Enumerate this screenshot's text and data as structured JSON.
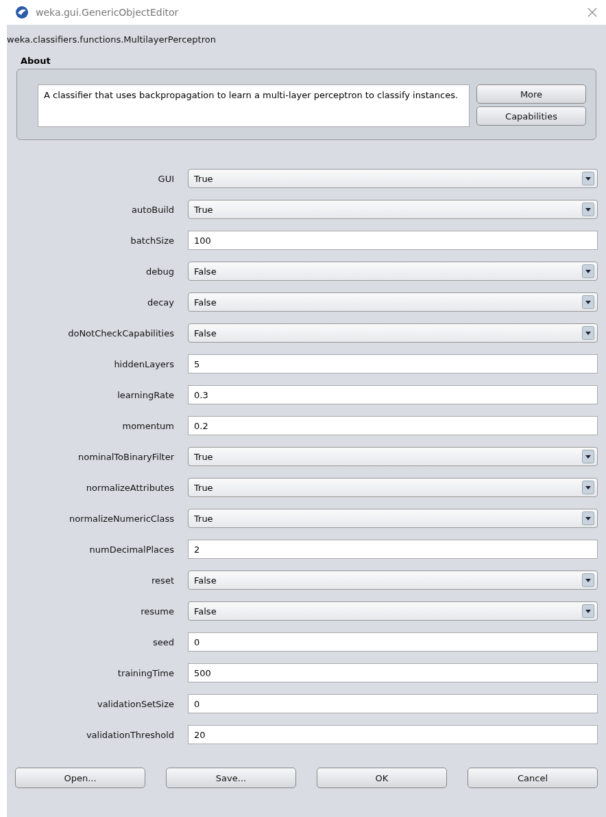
{
  "window": {
    "title": "weka.gui.GenericObjectEditor"
  },
  "class_name": "weka.classifiers.functions.MultilayerPerceptron",
  "about": {
    "heading": "About",
    "text": "A classifier that uses backpropagation to learn a multi-layer perceptron to classify instances.",
    "buttons": [
      "More",
      "Capabilities"
    ]
  },
  "properties": [
    {
      "label": "GUI",
      "kind": "dropdown",
      "value": "True"
    },
    {
      "label": "autoBuild",
      "kind": "dropdown",
      "value": "True"
    },
    {
      "label": "batchSize",
      "kind": "text",
      "value": "100"
    },
    {
      "label": "debug",
      "kind": "dropdown",
      "value": "False"
    },
    {
      "label": "decay",
      "kind": "dropdown",
      "value": "False"
    },
    {
      "label": "doNotCheckCapabilities",
      "kind": "dropdown",
      "value": "False"
    },
    {
      "label": "hiddenLayers",
      "kind": "text",
      "value": "5"
    },
    {
      "label": "learningRate",
      "kind": "text",
      "value": "0.3"
    },
    {
      "label": "momentum",
      "kind": "text",
      "value": "0.2"
    },
    {
      "label": "nominalToBinaryFilter",
      "kind": "dropdown",
      "value": "True"
    },
    {
      "label": "normalizeAttributes",
      "kind": "dropdown",
      "value": "True"
    },
    {
      "label": "normalizeNumericClass",
      "kind": "dropdown",
      "value": "True"
    },
    {
      "label": "numDecimalPlaces",
      "kind": "text",
      "value": "2"
    },
    {
      "label": "reset",
      "kind": "dropdown",
      "value": "False"
    },
    {
      "label": "resume",
      "kind": "dropdown",
      "value": "False"
    },
    {
      "label": "seed",
      "kind": "text",
      "value": "0"
    },
    {
      "label": "trainingTime",
      "kind": "text",
      "value": "500"
    },
    {
      "label": "validationSetSize",
      "kind": "text",
      "value": "0"
    },
    {
      "label": "validationThreshold",
      "kind": "text",
      "value": "20"
    }
  ],
  "buttons": [
    "Open...",
    "Save...",
    "OK",
    "Cancel"
  ]
}
